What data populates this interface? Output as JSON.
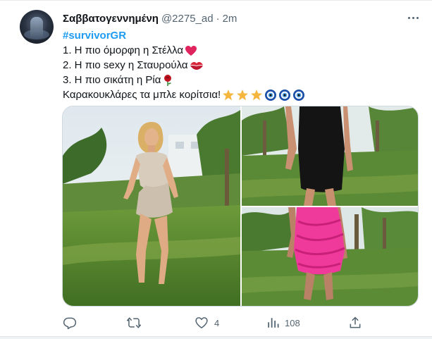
{
  "tweet": {
    "display_name": "Σαββατογεννημένη",
    "handle": "@2275_ad",
    "separator": "·",
    "time": "2m",
    "hashtag": "#survivorGR",
    "lines": [
      "1. Η πιο όμορφη η Στέλλα",
      "2. Η πιο sexy η Σταυρούλα",
      "3. Η πιο σικάτη η Ρία",
      "Καρακουκλάρες τα μπλε κορίτσια!"
    ],
    "emoji_icons": [
      "red-heart-icon",
      "kiss-mark-icon",
      "rose-icon",
      "star-icon",
      "nazar-amulet-icon"
    ],
    "images": [
      "photo-woman-beige-dress",
      "photo-woman-black-dress",
      "photo-woman-pink-ruffle-dress"
    ]
  },
  "actions": {
    "reply_count": "",
    "retweet_count": "",
    "like_count": "4",
    "views_count": "108"
  },
  "colors": {
    "link": "#1d9bf0",
    "text": "#0f1419",
    "muted": "#536471",
    "border": "#cfd9de"
  }
}
